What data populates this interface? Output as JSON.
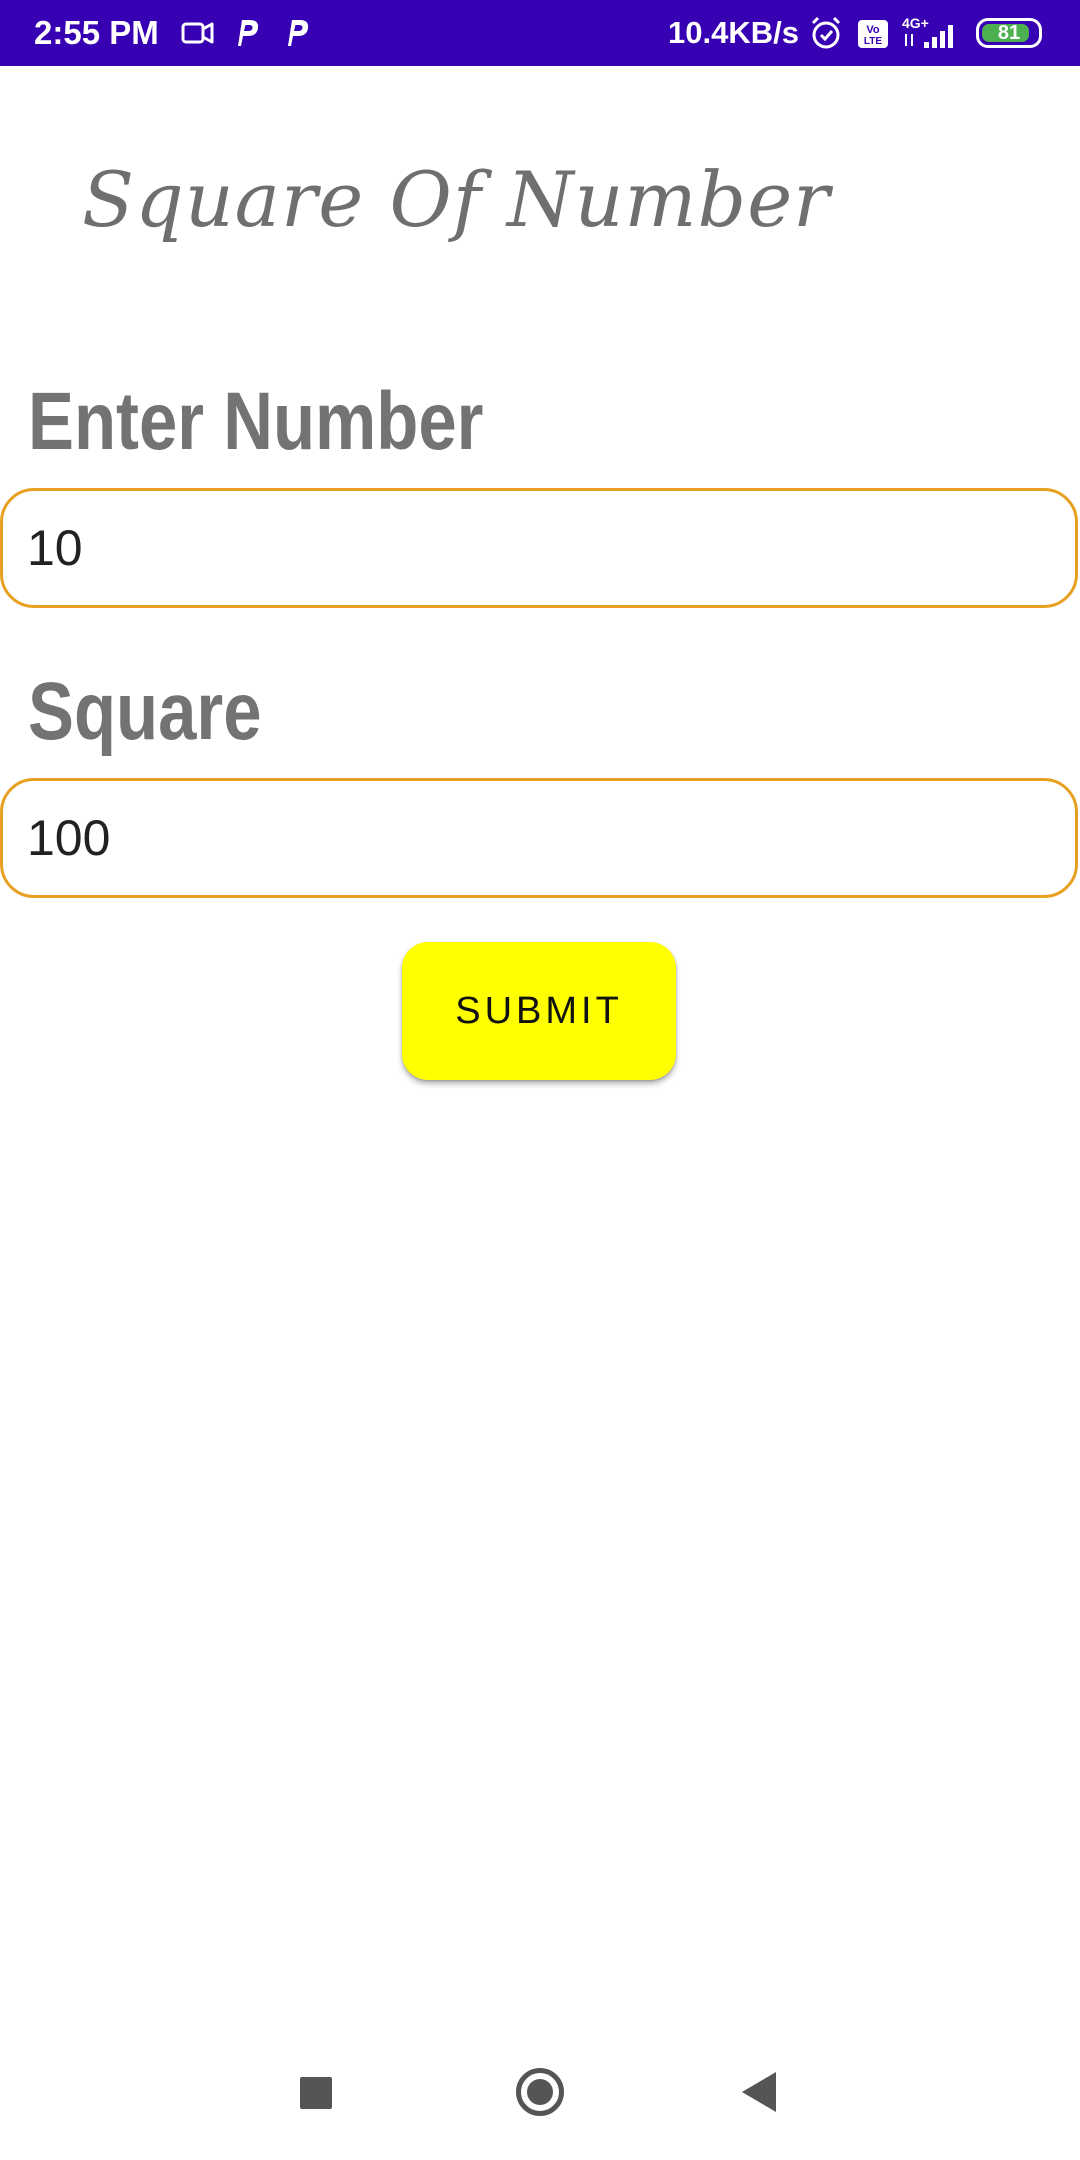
{
  "status_bar": {
    "time": "2:55 PM",
    "network_speed": "10.4KB/s",
    "battery_level": "81",
    "icons": [
      "video-camera-icon",
      "parking-p-icon",
      "parking-p-icon",
      "alarm-icon",
      "volte-icon",
      "signal-4g-icon",
      "battery-icon"
    ],
    "background_color": "#3700b3"
  },
  "app": {
    "title": "Square Of Number"
  },
  "form": {
    "number_label": "Enter Number",
    "number_value": "10",
    "square_label": "Square",
    "square_value": "100",
    "submit_label": "SUBMIT",
    "field_border_color": "#e8a022",
    "button_color": "#ffff00",
    "label_color": "#737373"
  },
  "nav_bar": {
    "icons": [
      "recent-apps-icon",
      "home-icon",
      "back-icon"
    ]
  }
}
